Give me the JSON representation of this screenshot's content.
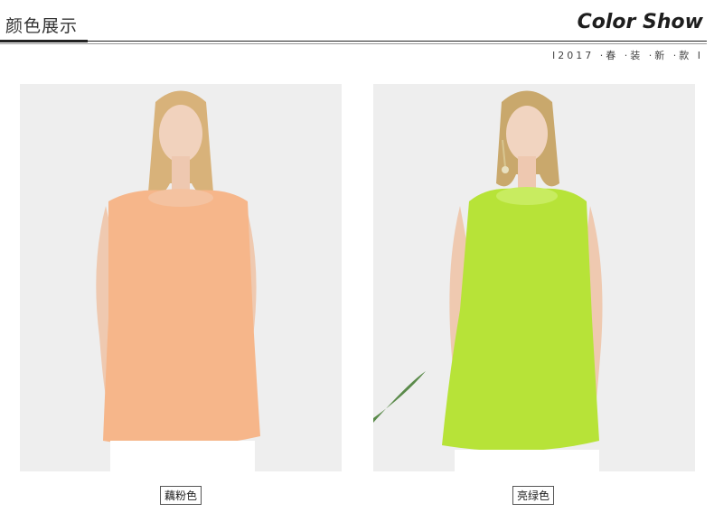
{
  "header": {
    "title_cn": "颜色展示",
    "title_en": "Color Show",
    "tagline": "I2017 ·春 ·装 ·新 ·款 I"
  },
  "products": [
    {
      "label": "藕粉色",
      "color": "#f6b68a"
    },
    {
      "label": "亮绿色",
      "color": "#b7e338"
    }
  ],
  "colors": {
    "background": "#ffffff",
    "photo_bg": "#eeeeee",
    "text": "#222222"
  }
}
